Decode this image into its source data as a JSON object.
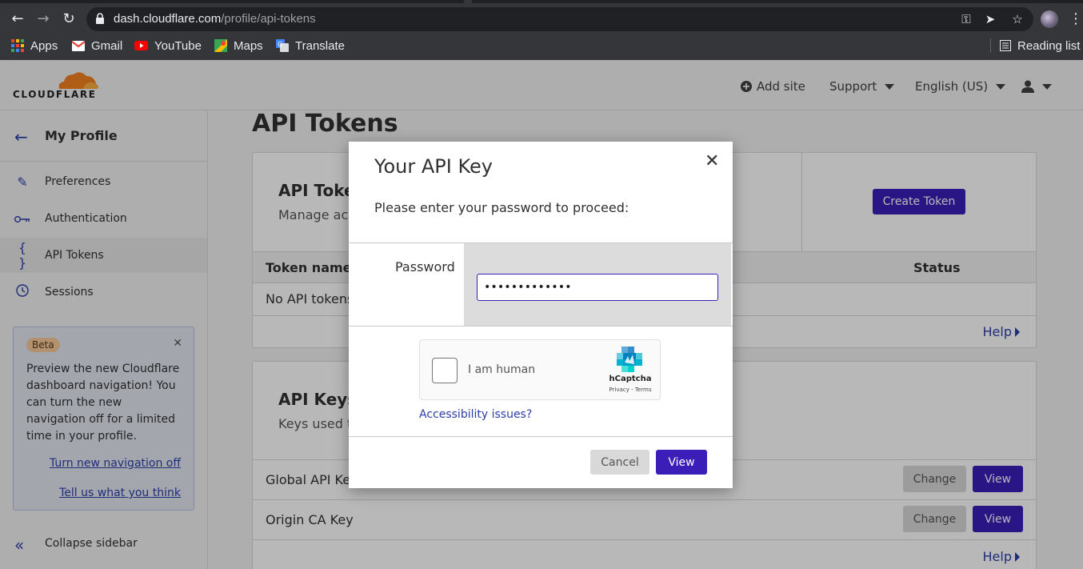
{
  "browser": {
    "url_host": "dash.cloudflare.com",
    "url_path": "/profile/api-tokens",
    "bookmarks": [
      {
        "label": "Apps",
        "color": "#ea4335"
      },
      {
        "label": "Gmail",
        "color": "#ea4335"
      },
      {
        "label": "YouTube",
        "color": "#ff0000"
      },
      {
        "label": "Maps",
        "color": "#34a853"
      },
      {
        "label": "Translate",
        "color": "#4285f4"
      }
    ],
    "reading_list": "Reading list"
  },
  "header": {
    "logo_text": "CLOUDFLARE",
    "add_site": "Add site",
    "support": "Support",
    "language": "English (US)"
  },
  "sidebar": {
    "title": "My Profile",
    "items": [
      {
        "label": "Preferences",
        "icon": "pencil-icon"
      },
      {
        "label": "Authentication",
        "icon": "key-icon"
      },
      {
        "label": "API Tokens",
        "icon": "braces-icon",
        "active": true
      },
      {
        "label": "Sessions",
        "icon": "clock-icon"
      }
    ],
    "beta": {
      "badge": "Beta",
      "text": "Preview the new Cloudflare dashboard navigation! You can turn the new navigation off for a limited time in your profile.",
      "link_off": "Turn new navigation off",
      "link_feedback": "Tell us what you think"
    },
    "collapse": "Collapse sidebar"
  },
  "main": {
    "page_title": "API Tokens",
    "tokens_card": {
      "heading": "API Tokens",
      "subtitle": "Manage access and permissions for your accounts, sites, and products",
      "create_button": "Create Token",
      "col_name": "Token name",
      "col_status": "Status",
      "empty": "No API tokens",
      "help": "Help"
    },
    "keys_card": {
      "heading": "API Keys",
      "subtitle": "Keys used to access Cloudflare APIs.",
      "rows": [
        {
          "label": "Global API Key",
          "change": "Change",
          "view": "View"
        },
        {
          "label": "Origin CA Key",
          "change": "Change",
          "view": "View"
        }
      ],
      "help": "Help"
    }
  },
  "modal": {
    "title": "Your API Key",
    "description": "Please enter your password to proceed:",
    "password_label": "Password",
    "password_value": "•••••••••••••",
    "captcha_label": "I am human",
    "captcha_brand": "hCaptcha",
    "captcha_links": "Privacy - Terms",
    "accessibility": "Accessibility issues?",
    "cancel": "Cancel",
    "view": "View"
  },
  "colors": {
    "accent": "#3b1eb8",
    "link": "#2c3ea8",
    "cloudflare_orange": "#f38020"
  }
}
